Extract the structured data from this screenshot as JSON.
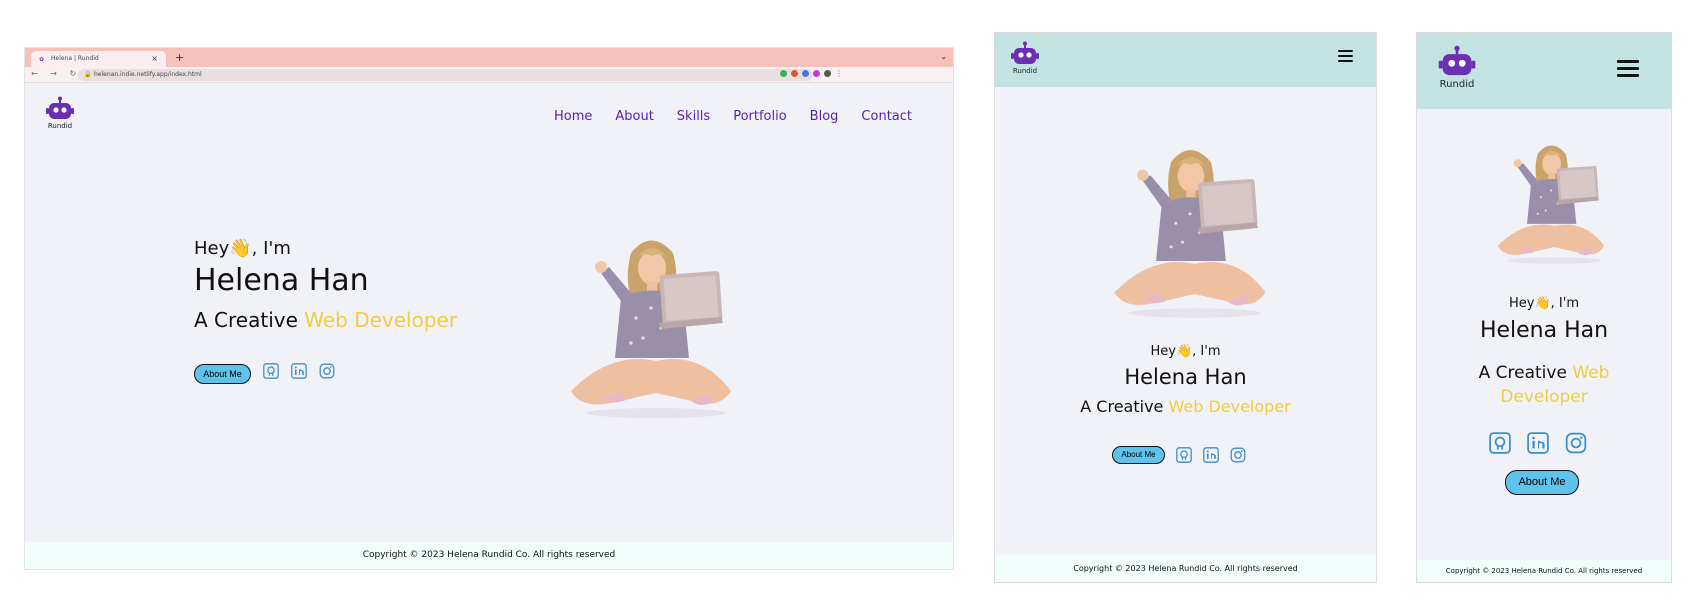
{
  "browser": {
    "tab_title": "Helena | Rundid",
    "tab_close": "×",
    "new_tab": "+",
    "tab_menu": "⌄",
    "nav_buttons": "← → ↻",
    "url": "helenan.indie.netlify.app/index.html",
    "extension_colors": [
      "#3fae5b",
      "#e2572b",
      "#3d7be0",
      "#c43bd1",
      "#555555"
    ]
  },
  "brand": {
    "logo_text": "Rundid",
    "logo_color": "#6a2fb3"
  },
  "nav": {
    "items": [
      "Home",
      "About",
      "Skills",
      "Portfolio",
      "Blog",
      "Contact"
    ]
  },
  "hero": {
    "greeting": "Hey👋, I'm",
    "name": "Helena Han",
    "role_prefix": "A Creative ",
    "role_accent": "Web Developer",
    "role_accent_line1": "Web",
    "role_accent_line2": "Developer",
    "about_button": "About Me"
  },
  "social": [
    {
      "icon": "github-icon"
    },
    {
      "icon": "linkedin-icon"
    },
    {
      "icon": "instagram-icon"
    }
  ],
  "footer": {
    "text": "Copyright © 2023 Helena Rundid Co. All rights reserved"
  },
  "colors": {
    "accent_yellow": "#f2cc3f",
    "nav_purple": "#5b1fa8",
    "button_blue": "#5ec2ea",
    "social_blue": "#3c8fc6",
    "header_teal": "#c3e2e2",
    "tabbar_pink": "#f4c1bb"
  }
}
